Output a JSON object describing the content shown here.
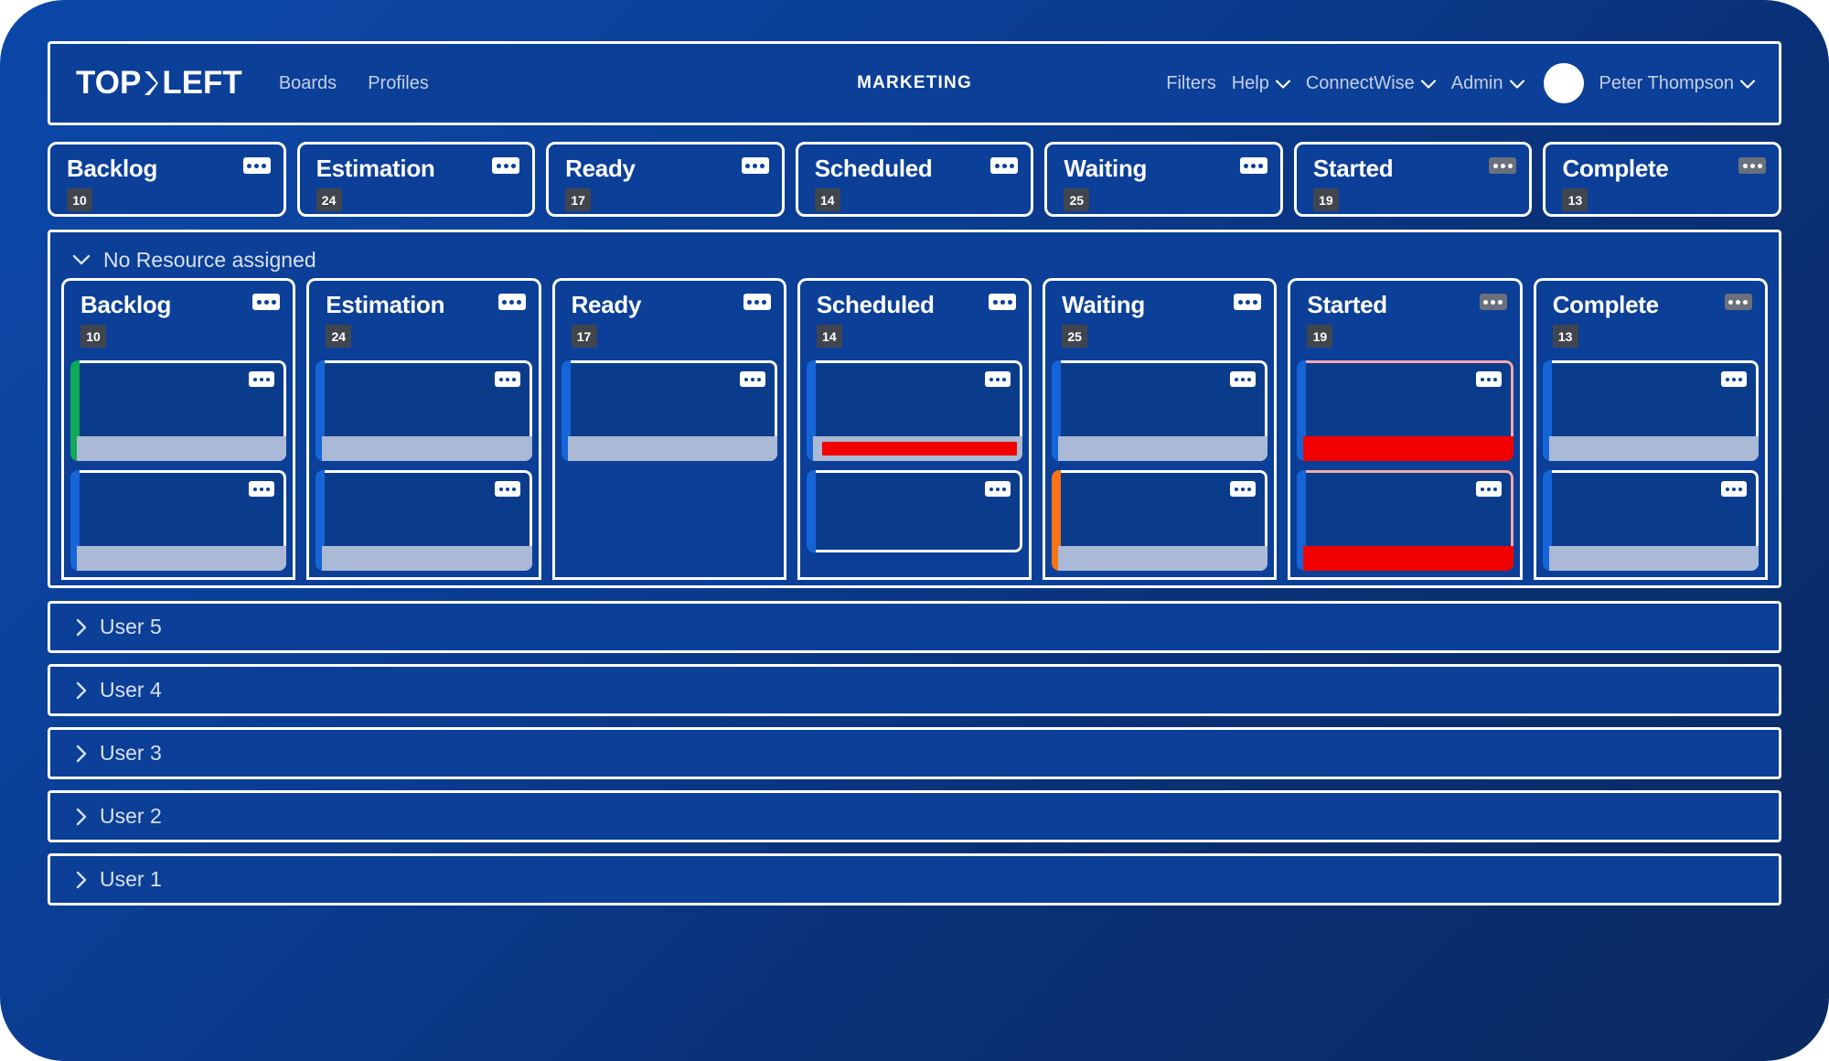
{
  "header": {
    "logo": {
      "left": "TOP",
      "right": "LEFT",
      "icon": "chevron-right-logo-icon"
    },
    "nav": [
      {
        "label": "Boards"
      },
      {
        "label": "Profiles"
      }
    ],
    "board_title": "MARKETING",
    "right_nav": [
      {
        "label": "Filters",
        "caret": false
      },
      {
        "label": "Help",
        "caret": true
      },
      {
        "label": "ConnectWise",
        "caret": true
      },
      {
        "label": "Admin",
        "caret": true
      }
    ],
    "user": {
      "name": "Peter Thompson",
      "caret": true
    }
  },
  "columns": [
    {
      "name": "Backlog",
      "count": "10",
      "kebab_style": "white"
    },
    {
      "name": "Estimation",
      "count": "24",
      "kebab_style": "white"
    },
    {
      "name": "Ready",
      "count": "17",
      "kebab_style": "white"
    },
    {
      "name": "Scheduled",
      "count": "14",
      "kebab_style": "white"
    },
    {
      "name": "Waiting",
      "count": "25",
      "kebab_style": "white"
    },
    {
      "name": "Started",
      "count": "19",
      "kebab_style": "gray"
    },
    {
      "name": "Complete",
      "count": "13",
      "kebab_style": "gray"
    }
  ],
  "swimlane": {
    "title": "No Resource assigned",
    "expanded": true,
    "toggle_icon": "chevron-down-icon",
    "columns": [
      {
        "name": "Backlog",
        "count": "10",
        "kebab_style": "white",
        "cards": [
          {
            "stripe_color": "#0fa958",
            "footer": "bar",
            "alert": false
          },
          {
            "stripe_color": "#1565d8",
            "footer": "bar",
            "alert": false
          }
        ]
      },
      {
        "name": "Estimation",
        "count": "24",
        "kebab_style": "white",
        "cards": [
          {
            "stripe_color": "#1565d8",
            "footer": "bar",
            "alert": false
          },
          {
            "stripe_color": "#1565d8",
            "footer": "bar",
            "alert": false
          }
        ]
      },
      {
        "name": "Ready",
        "count": "17",
        "kebab_style": "white",
        "cards": [
          {
            "stripe_color": "#1565d8",
            "footer": "bar",
            "alert": false
          }
        ]
      },
      {
        "name": "Scheduled",
        "count": "14",
        "kebab_style": "white",
        "cards": [
          {
            "stripe_color": "#1565d8",
            "footer": "progress-red",
            "alert": false
          },
          {
            "stripe_color": "#1565d8",
            "footer": "none",
            "alert": false
          }
        ]
      },
      {
        "name": "Waiting",
        "count": "25",
        "kebab_style": "white",
        "cards": [
          {
            "stripe_color": "#1565d8",
            "footer": "bar",
            "alert": false
          },
          {
            "stripe_color": "#f97316",
            "footer": "bar",
            "alert": false
          }
        ]
      },
      {
        "name": "Started",
        "count": "19",
        "kebab_style": "gray",
        "cards": [
          {
            "stripe_color": "#1565d8",
            "footer": "solid-red",
            "alert": true
          },
          {
            "stripe_color": "#1565d8",
            "footer": "solid-red",
            "alert": true
          }
        ]
      },
      {
        "name": "Complete",
        "count": "13",
        "kebab_style": "gray",
        "cards": [
          {
            "stripe_color": "#1565d8",
            "footer": "bar",
            "alert": false
          },
          {
            "stripe_color": "#1565d8",
            "footer": "bar",
            "alert": false
          }
        ]
      }
    ]
  },
  "user_rows": [
    {
      "label": "User 5",
      "expanded": false,
      "toggle_icon": "chevron-right-icon"
    },
    {
      "label": "User 4",
      "expanded": false,
      "toggle_icon": "chevron-right-icon"
    },
    {
      "label": "User 3",
      "expanded": false,
      "toggle_icon": "chevron-right-icon"
    },
    {
      "label": "User 2",
      "expanded": false,
      "toggle_icon": "chevron-right-icon"
    },
    {
      "label": "User 1",
      "expanded": false,
      "toggle_icon": "chevron-right-icon"
    }
  ],
  "colors": {
    "background_start": "#0b47a8",
    "background_end": "#0b2a63",
    "panel": "#0b3f98",
    "card_body": "#0b3c8c",
    "border": "#ffffff",
    "badge": "#41464e",
    "stripe_blue": "#1565d8",
    "stripe_green": "#0fa958",
    "stripe_orange": "#f97316",
    "alert_red": "#f20000",
    "alert_border": "#f5a9a9",
    "footer_gray": "#aab9d5",
    "muted_text": "#c5cfe3"
  }
}
